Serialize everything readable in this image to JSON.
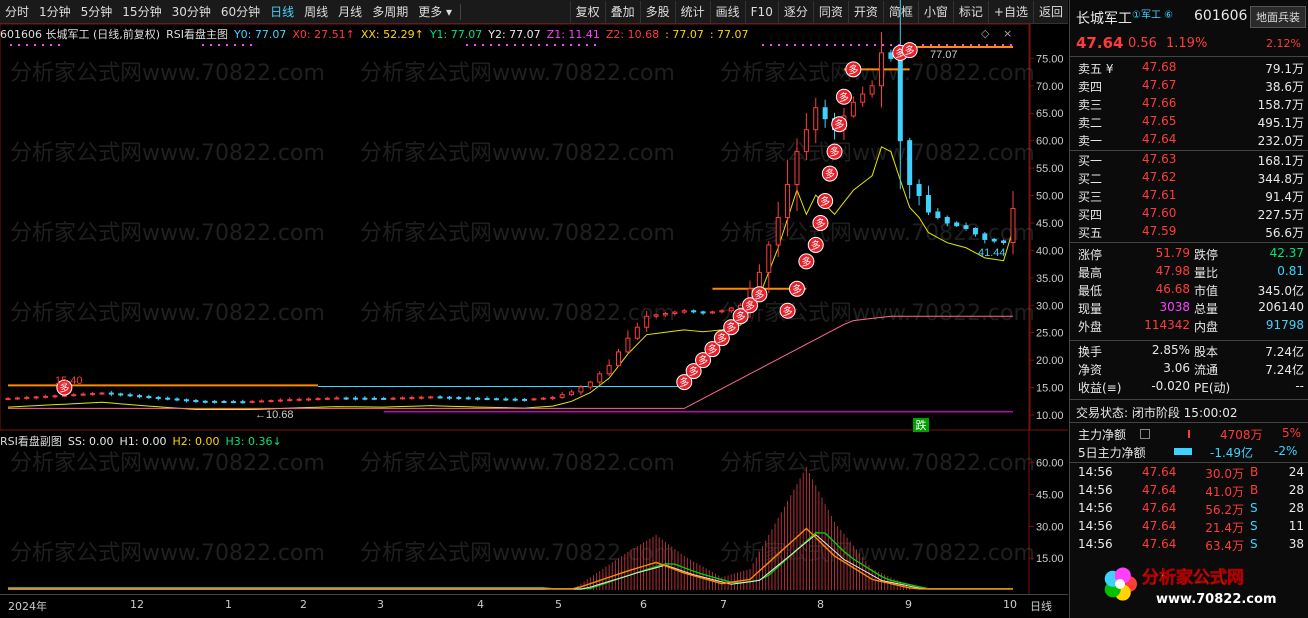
{
  "toolbar": {
    "items": [
      "分时",
      "1分钟",
      "5分钟",
      "15分钟",
      "30分钟",
      "60分钟",
      "日线",
      "周线",
      "月线",
      "多周期",
      "更多 ▾"
    ],
    "active": "日线",
    "right": [
      "复权",
      "叠加",
      "多股",
      "统计",
      "画线",
      "F10",
      "逐分",
      "同资",
      "开资",
      "简框",
      "小窗",
      "标记",
      "+自选",
      "返回"
    ]
  },
  "main": {
    "stock": "601606 长城军工 (日线,前复权)",
    "indicator": "RSI看盘主图",
    "y0": "Y0: 77.07",
    "x0": "X0: 27.51↑",
    "xx": "XX: 52.29↑",
    "y1": "Y1: 77.07",
    "y2": "Y2: 77.07",
    "z1": "Z1: 11.41",
    "z2": "Z2: 10.68",
    "z3": ": 77.07",
    "z4": ": 77.07",
    "yticks": [
      "75.00",
      "70.00",
      "65.00",
      "60.00",
      "55.00",
      "50.00",
      "45.00",
      "40.00",
      "35.00",
      "30.00",
      "25.00",
      "20.00",
      "15.00",
      "10.00"
    ],
    "ann_high": "77.07",
    "ann_low": "←10.68",
    "ann_start": "15.40",
    "ann_last": "41.44",
    "badge_duo": "多",
    "badge_die": "跌"
  },
  "sub": {
    "indicator": "RSI看盘副图",
    "ss": "SS: 0.00",
    "h1": "H1: 0.00",
    "h2": "H2: 0.00",
    "h3": "H3: 0.36↓",
    "yticks": [
      "60.00",
      "45.00",
      "30.00",
      "15.00"
    ]
  },
  "xaxis": {
    "labels": [
      "2024年",
      "12",
      "1",
      "2",
      "3",
      "4",
      "5",
      "6",
      "7",
      "8",
      "9",
      "10"
    ],
    "period": "日线"
  },
  "watermark": "分析家公式网www.70822.com",
  "quote": {
    "name": "长城军工",
    "tags": "①军工 ⑥",
    "code": "601606",
    "board": "地面兵装",
    "price": "47.64",
    "change": "0.56",
    "pct": "1.19%",
    "bpct": "2.12%",
    "asks": [
      {
        "l": "卖五 ¥",
        "p": "47.68",
        "v": "79.1万"
      },
      {
        "l": "卖四",
        "p": "47.67",
        "v": "38.6万"
      },
      {
        "l": "卖三",
        "p": "47.66",
        "v": "158.7万"
      },
      {
        "l": "卖二",
        "p": "47.65",
        "v": "495.1万"
      },
      {
        "l": "卖一",
        "p": "47.64",
        "v": "232.0万"
      }
    ],
    "bids": [
      {
        "l": "买一",
        "p": "47.63",
        "v": "168.1万"
      },
      {
        "l": "买二",
        "p": "47.62",
        "v": "344.8万"
      },
      {
        "l": "买三",
        "p": "47.61",
        "v": "91.4万"
      },
      {
        "l": "买四",
        "p": "47.60",
        "v": "227.5万"
      },
      {
        "l": "买五",
        "p": "47.59",
        "v": "56.6万"
      }
    ],
    "stats": [
      {
        "a": "涨停",
        "av": "51.79",
        "ac": "red",
        "b": "跌停",
        "bv": "42.37",
        "bc": "grn"
      },
      {
        "a": "最高",
        "av": "47.98",
        "ac": "red",
        "b": "量比",
        "bv": "0.81",
        "bc": "cyan"
      },
      {
        "a": "最低",
        "av": "46.68",
        "ac": "red",
        "b": "市值",
        "bv": "345.0亿",
        "bc": "wht"
      },
      {
        "a": "现量",
        "av": "3038",
        "ac": "mag",
        "b": "总量",
        "bv": "206140",
        "bc": "wht"
      },
      {
        "a": "外盘",
        "av": "114342",
        "ac": "red",
        "b": "内盘",
        "bv": "91798",
        "bc": "cyan"
      }
    ],
    "stats2": [
      {
        "a": "换手",
        "av": "2.85%",
        "b": "股本",
        "bv": "7.24亿"
      },
      {
        "a": "净资",
        "av": "3.06",
        "b": "流通",
        "bv": "7.24亿"
      },
      {
        "a": "收益(≡)",
        "av": "-0.020",
        "b": "PE(动)",
        "bv": "--"
      }
    ],
    "status": "交易状态: 闭市阶段 15:00:02",
    "flow1": {
      "l": "主力净额",
      "v": "4708万",
      "p": "5%"
    },
    "flow2": {
      "l": "5日主力净额",
      "v": "-1.49亿",
      "p": "-2%"
    },
    "ticks": [
      {
        "t": "14:56",
        "p": "47.64",
        "v": "30.0万",
        "d": "B",
        "n": "24"
      },
      {
        "t": "14:56",
        "p": "47.64",
        "v": "41.0万",
        "d": "B",
        "n": "28"
      },
      {
        "t": "14:56",
        "p": "47.64",
        "v": "56.2万",
        "d": "S",
        "n": "28"
      },
      {
        "t": "14:56",
        "p": "47.64",
        "v": "21.4万",
        "d": "S",
        "n": "11"
      },
      {
        "t": "14:56",
        "p": "47.64",
        "v": "63.4万",
        "d": "S",
        "n": "38"
      }
    ]
  },
  "logo": {
    "text": "分析家公式网",
    "url": "www.70822.com"
  },
  "colors": {
    "up": "#ff3c3c",
    "down": "#3fd2ff",
    "yellow": "#e6e600",
    "orange": "#ff8a00",
    "magenta": "#ff40ff"
  },
  "chart_data": {
    "type": "candlestick",
    "price_range": [
      10,
      77.07
    ],
    "close_path": [
      [
        0,
        13
      ],
      [
        5,
        13.5
      ],
      [
        10,
        14
      ],
      [
        15,
        13.2
      ],
      [
        20,
        12.5
      ],
      [
        25,
        12.4
      ],
      [
        30,
        12.8
      ],
      [
        35,
        13.1
      ],
      [
        40,
        13.0
      ],
      [
        45,
        13.3
      ],
      [
        50,
        13.0
      ],
      [
        55,
        12.8
      ],
      [
        58,
        13.2
      ],
      [
        60,
        14.2
      ],
      [
        62,
        16
      ],
      [
        64,
        19
      ],
      [
        66,
        24
      ],
      [
        68,
        28
      ],
      [
        70,
        28.5
      ],
      [
        72,
        29
      ],
      [
        74,
        28.6
      ],
      [
        76,
        29
      ],
      [
        78,
        30
      ],
      [
        80,
        36
      ],
      [
        82,
        46
      ],
      [
        84,
        58
      ],
      [
        86,
        66
      ],
      [
        88,
        62
      ],
      [
        90,
        67
      ],
      [
        92,
        70
      ],
      [
        93,
        76
      ],
      [
        94,
        75
      ],
      [
        95,
        60
      ],
      [
        96,
        52
      ],
      [
        97,
        50
      ],
      [
        98,
        47
      ],
      [
        100,
        45
      ],
      [
        102,
        44
      ],
      [
        104,
        42
      ],
      [
        106,
        41.44
      ],
      [
        107,
        47.64
      ]
    ],
    "sub_peaks": [
      [
        60,
        0
      ],
      [
        66,
        18
      ],
      [
        69,
        26
      ],
      [
        72,
        16
      ],
      [
        76,
        6
      ],
      [
        79,
        10
      ],
      [
        82,
        34
      ],
      [
        85,
        58
      ],
      [
        88,
        32
      ],
      [
        92,
        10
      ],
      [
        96,
        2
      ]
    ]
  }
}
